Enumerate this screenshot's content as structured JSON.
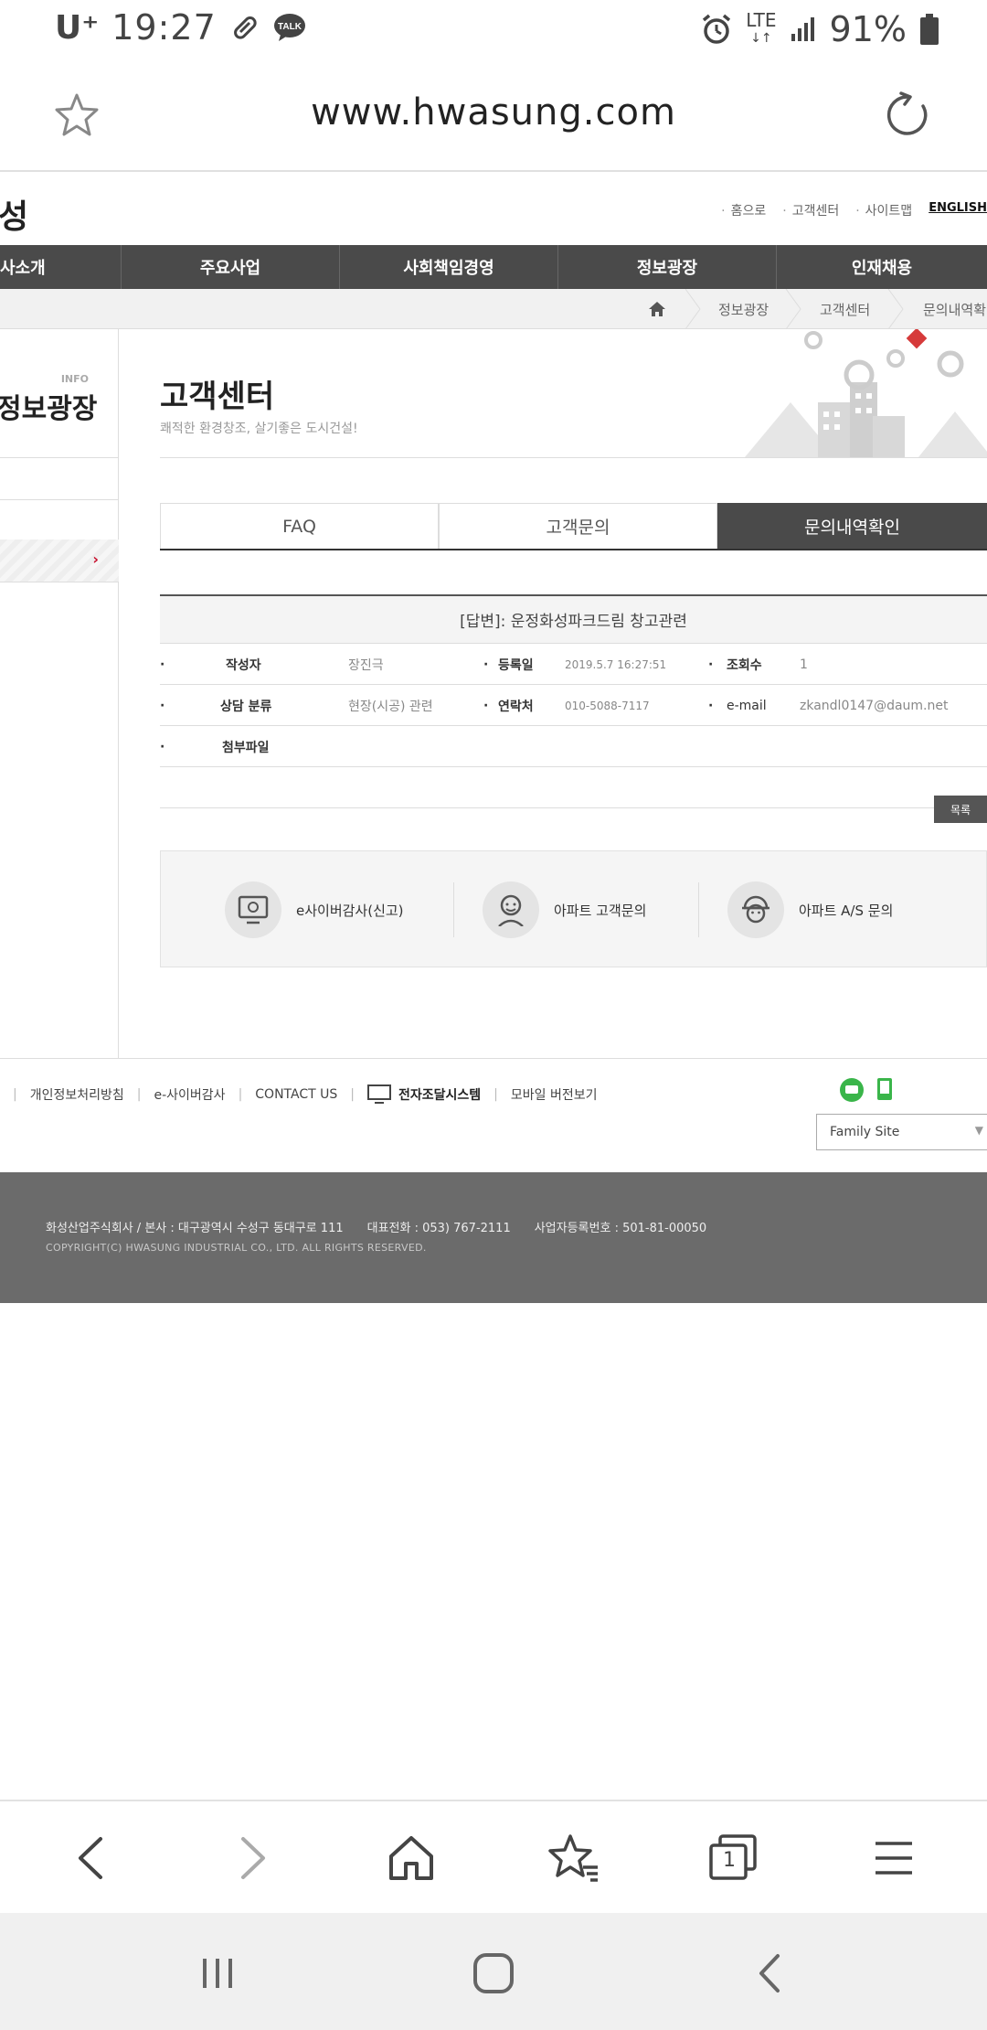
{
  "status_bar": {
    "carrier": "U⁺",
    "time": "19:27",
    "network": "LTE",
    "battery": "91%"
  },
  "browser": {
    "url": "www.hwasung.com"
  },
  "site": {
    "logo_fragment": "성",
    "util_links": [
      "홈으로",
      "고객센터",
      "사이트맵"
    ],
    "english_link": "ENGLISH",
    "gnb": [
      "사소개",
      "주요사업",
      "사회책임경영",
      "정보광장",
      "인재채용"
    ],
    "breadcrumb": [
      "정보광장",
      "고객센터",
      "문의내역확인"
    ],
    "lnb": {
      "small_label": "INFO",
      "title": "정보광장"
    },
    "page": {
      "title": "고객센터",
      "subtitle": "쾌적한 환경창조, 살기좋은 도시건설!"
    },
    "tabs": [
      {
        "label": "FAQ",
        "active": false
      },
      {
        "label": "고객문의",
        "active": false
      },
      {
        "label": "문의내역확인",
        "active": true
      }
    ],
    "post": {
      "subject": "[답변]: 운정화성파크드림 창고관련",
      "author_label": "작성자",
      "author": "장진극",
      "date_label": "등록일",
      "date": "2019.5.7 16:27:51",
      "views_label": "조회수",
      "views": "1",
      "category_label": "상담 분류",
      "category": "현장(시공) 관련",
      "contact_label": "연락처",
      "contact": "010-5088-7117",
      "email_label": "e-mail",
      "email": "zkandl0147@daum.net",
      "attachment_label": "첨부파일"
    },
    "list_button": "목록",
    "quick_links": [
      "e사이버감사(신고)",
      "아파트 고객문의",
      "아파트 A/S 문의"
    ],
    "footer_links": [
      "개인정보처리방침",
      "e-사이버감사",
      "CONTACT US",
      "전자조달시스템",
      "모바일 버전보기"
    ],
    "family_site": "Family Site",
    "footer_info": {
      "company": "화성산업주식회사 / 본사 : 대구광역시 수성구 동대구로 111",
      "phone": "대표전화 : 053) 767-2111",
      "biz_no": "사업자등록번호 : 501-81-00050",
      "copyright": "COPYRIGHT(C) HWASUNG INDUSTRIAL CO., LTD. ALL RIGHTS RESERVED."
    }
  },
  "colors": {
    "gnb_bg": "#4a4a4a",
    "accent": "#c8102e",
    "footer_bg": "#6b6b6b"
  },
  "icons": {
    "toolbar": [
      "back-icon",
      "forward-icon",
      "home-icon",
      "bookmarks-icon",
      "tabs-icon",
      "menu-icon"
    ],
    "tabs_count": "1"
  }
}
